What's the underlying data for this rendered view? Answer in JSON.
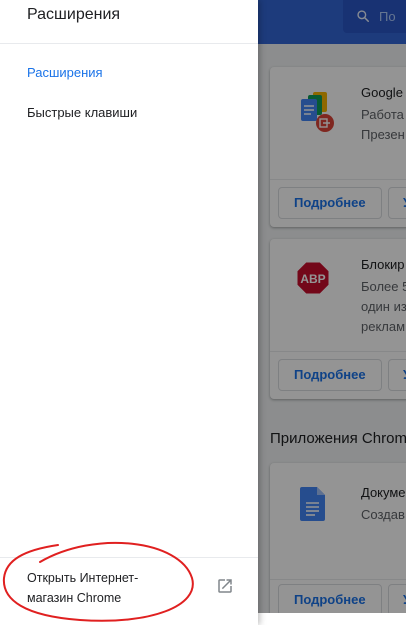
{
  "header": {
    "search_placeholder": "По"
  },
  "drawer": {
    "title": "Расширения",
    "nav": [
      {
        "label": "Расширения",
        "active": true
      },
      {
        "label": "Быстрые клавиши",
        "active": false
      }
    ],
    "store_link": "Открыть Интернет-магазин Chrome",
    "store_icon": "open-in-new-icon"
  },
  "cards": [
    {
      "title": "Google ,",
      "desc": [
        "Работа",
        "Презен"
      ],
      "icon": "google-docs-offline-icon",
      "details_label": "Подробнее",
      "remove_label": "У"
    },
    {
      "title": "Блокир",
      "desc": [
        "Более 5",
        "один из",
        "реклам"
      ],
      "icon": "adblock-plus-icon",
      "icon_text": "ABP",
      "details_label": "Подробнее",
      "remove_label": "У"
    },
    {
      "title": "Докуме",
      "desc": [
        "Создав"
      ],
      "icon": "google-docs-icon",
      "details_label": "Подробнее",
      "remove_label": "У"
    }
  ],
  "apps_section_title": "Приложения Chrome",
  "colors": {
    "header_blue": "#3367d6",
    "link_blue": "#1a73e8",
    "annotation_red": "#e02020"
  }
}
